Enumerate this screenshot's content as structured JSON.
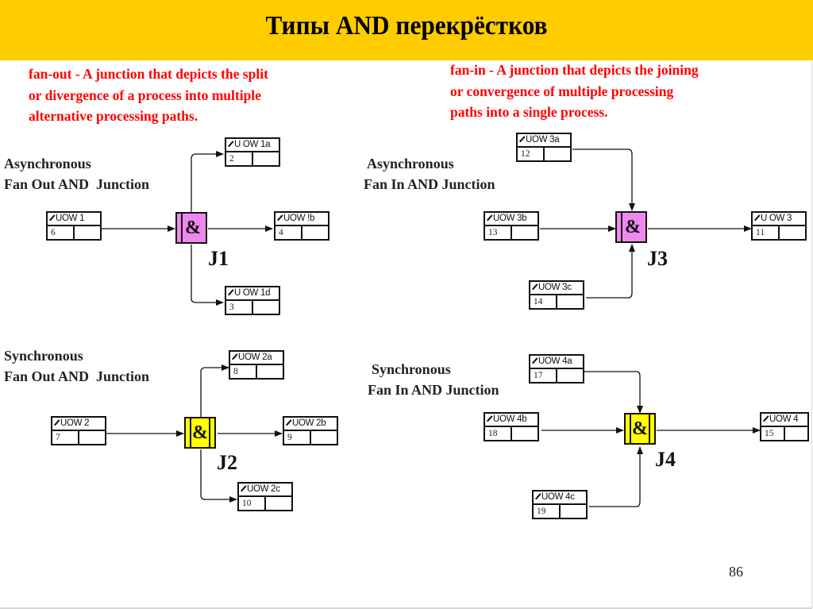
{
  "slide": {
    "title": "Типы AND перекрёстков",
    "page_number": "86",
    "colors": {
      "title_bar": "#ffcc00",
      "definition_text": "#ff0000",
      "async_junction_fill": "#ee88ee",
      "sync_junction_fill": "#ffff00"
    }
  },
  "definitions": {
    "fan_out": [
      "fan-out - A junction that depicts  the split",
      "or divergence of a process into multiple",
      "alternative processing paths."
    ],
    "fan_in": [
      "fan-in - A junction that depicts  the joining",
      "or convergence of multiple processing",
      "paths into a single process."
    ]
  },
  "diagrams": [
    {
      "id": "j1",
      "label_lines": [
        "Asynchronous",
        "Fan Out AND  Junction"
      ],
      "junction": {
        "symbol": "&",
        "name": "J1",
        "kind": "asynchronous"
      },
      "nodes": [
        {
          "name": "UOW 1",
          "number": "6"
        },
        {
          "name": "U OW 1a",
          "number": "2"
        },
        {
          "name": "UOW !b",
          "number": "4"
        },
        {
          "name": "U OW 1d",
          "number": "3"
        }
      ]
    },
    {
      "id": "j2",
      "label_lines": [
        "Synchronous",
        "Fan Out AND  Junction"
      ],
      "junction": {
        "symbol": "&",
        "name": "J2",
        "kind": "synchronous"
      },
      "nodes": [
        {
          "name": "UOW 2",
          "number": "7"
        },
        {
          "name": "UOW 2a",
          "number": "8"
        },
        {
          "name": "UOW 2b",
          "number": "9"
        },
        {
          "name": "UOW 2c",
          "number": "10"
        }
      ]
    },
    {
      "id": "j3",
      "label_lines": [
        "Asynchronous",
        "Fan In AND Junction"
      ],
      "junction": {
        "symbol": "&",
        "name": "J3",
        "kind": "asynchronous"
      },
      "nodes": [
        {
          "name": "UOW 3a",
          "number": "12"
        },
        {
          "name": "UOW 3b",
          "number": "13"
        },
        {
          "name": "UOW 3c",
          "number": "14"
        },
        {
          "name": "U OW 3",
          "number": "11"
        }
      ]
    },
    {
      "id": "j4",
      "label_lines": [
        "Synchronous",
        "Fan In AND Junction"
      ],
      "junction": {
        "symbol": "&",
        "name": "J4",
        "kind": "synchronous"
      },
      "nodes": [
        {
          "name": "UOW 4a",
          "number": "17"
        },
        {
          "name": "UOW 4b",
          "number": "18"
        },
        {
          "name": "UOW 4c",
          "number": "19"
        },
        {
          "name": "UOW 4",
          "number": "15"
        }
      ]
    }
  ]
}
